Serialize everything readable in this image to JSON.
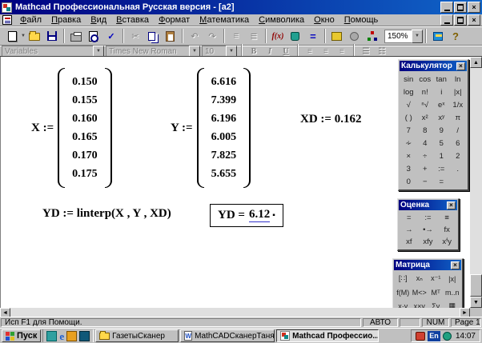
{
  "window": {
    "title": "Mathcad Профессиональная Русская версия - [a2]"
  },
  "menubar": {
    "items": [
      "Файл",
      "Правка",
      "Вид",
      "Вставка",
      "Формат",
      "Математика",
      "Символика",
      "Окно",
      "Помощь"
    ]
  },
  "icons": {
    "dropdown": "▼",
    "up": "▲",
    "down": "▼",
    "left": "◄",
    "right": "►",
    "cut": "✂",
    "undo": "↶",
    "redo": "↷",
    "check": "✓",
    "close": "×",
    "function": "f(x)",
    "evaluate": "=",
    "help": "?",
    "align_across": "≡",
    "align_down": "≣",
    "align_left": "≡",
    "align_center": "≡",
    "align_right": "≡",
    "bullet_list": "☰",
    "number_list": "☷"
  },
  "toolbar": {
    "zoom_value": "150%"
  },
  "formatbar": {
    "style_value": "Variables",
    "font_value": "Times New Roman",
    "size_value": "10",
    "bold": "B",
    "italic": "I",
    "underline": "U"
  },
  "worksheet": {
    "x_vector": {
      "label": "X :=",
      "values": [
        "0.150",
        "0.155",
        "0.160",
        "0.165",
        "0.170",
        "0.175"
      ]
    },
    "y_vector": {
      "label": "Y :=",
      "values": [
        "6.616",
        "7.399",
        "6.196",
        "6.005",
        "7.825",
        "5.655"
      ]
    },
    "xd_definition": "XD := 0.162",
    "yd_definition": "YD := linterp(X , Y , XD)",
    "yd_result": {
      "label": "YD =",
      "value": "6.12",
      "cursor": "▪"
    }
  },
  "palettes": {
    "calculator": {
      "title": "Калькулятор",
      "buttons": [
        "sin",
        "cos",
        "tan",
        "ln",
        "log",
        "n!",
        "i",
        "|x|",
        "√",
        "ⁿ√",
        "eˣ",
        "1/x",
        "( )",
        "x²",
        "xʸ",
        "π",
        "7",
        "8",
        "9",
        "/",
        "∻",
        "4",
        "5",
        "6",
        "×",
        "÷",
        "1",
        "2",
        "3",
        "+",
        ":=",
        ".",
        "0",
        "−",
        "="
      ]
    },
    "evaluation": {
      "title": "Оценка",
      "buttons": [
        "=",
        ":=",
        "≡",
        "→",
        "•→",
        "fx",
        "xf",
        "xfy",
        "xᶠy"
      ]
    },
    "matrix": {
      "title": "Матрица",
      "buttons": [
        "[∷]",
        "xₙ",
        "x⁻¹",
        "|x|",
        "f(M)",
        "M<>",
        "Mᵀ",
        "m..n",
        "x·y",
        "x×y",
        "Σv",
        "▦"
      ]
    }
  },
  "statusbar": {
    "message": "Исп F1 для Помощи.",
    "auto": "АВТО",
    "blank": "",
    "num": "NUM",
    "page": "Page 1"
  },
  "taskbar": {
    "start_label": "Пуск",
    "tasks": [
      {
        "label": "ГазетыСканер"
      },
      {
        "label": "MathCADСканерТаня - M..."
      },
      {
        "label": "Mathcad Профессио..."
      }
    ],
    "tray": {
      "lang": "En",
      "time": "14:07"
    }
  }
}
